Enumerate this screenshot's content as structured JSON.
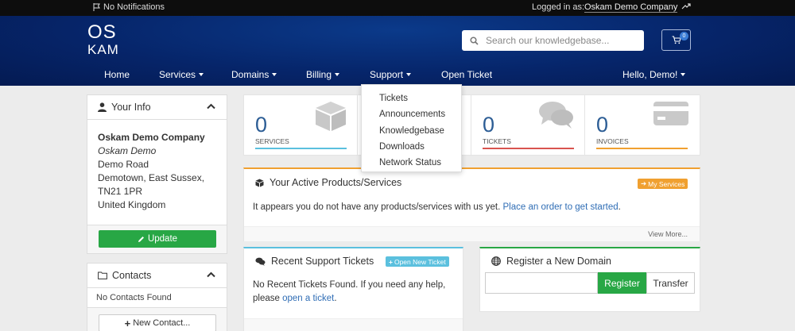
{
  "topbar": {
    "notifications": "No Notifications",
    "logged_in_as": "Logged in as:",
    "company": "Oskam Demo Company"
  },
  "header": {
    "logo_line1": "OS",
    "logo_line2": "KAM",
    "search_placeholder": "Search our knowledgebase...",
    "cart_count": "0"
  },
  "nav": {
    "home": "Home",
    "services": "Services",
    "domains": "Domains",
    "billing": "Billing",
    "support": "Support",
    "open_ticket": "Open Ticket",
    "hello": "Hello, Demo!"
  },
  "support_menu": [
    "Tickets",
    "Announcements",
    "Knowledgebase",
    "Downloads",
    "Network Status"
  ],
  "your_info": {
    "title": "Your Info",
    "company": "Oskam Demo Company",
    "contact_name": "Oskam Demo",
    "address1": "Demo Road",
    "address2": "Demotown, East Sussex,",
    "postcode": "TN21 1PR",
    "country": "United Kingdom",
    "update_label": "Update"
  },
  "contacts": {
    "title": "Contacts",
    "empty": "No Contacts Found",
    "new_contact": "New Contact..."
  },
  "stats": {
    "services": {
      "value": "0",
      "label": "SERVICES"
    },
    "tickets": {
      "value": "0",
      "label": "TICKETS"
    },
    "invoices": {
      "value": "0",
      "label": "INVOICES"
    }
  },
  "products": {
    "title": "Your Active Products/Services",
    "my_services": "My Services",
    "message": "It appears you do not have any products/services with us yet.",
    "order_link": "Place an order to get started",
    "view_more": "View More..."
  },
  "tickets_panel": {
    "title": "Recent Support Tickets",
    "open_new": "Open New Ticket",
    "message": "No Recent Tickets Found. If you need any help, please",
    "link": "open a ticket"
  },
  "domain_panel": {
    "title": "Register a New Domain",
    "register": "Register",
    "transfer": "Transfer"
  },
  "colors": {
    "header_blue": "#06256a",
    "services_bar": "#5bc0de",
    "tickets_bar": "#d9534f",
    "invoices_bar": "#f0a030",
    "accent_green": "#28a745"
  }
}
